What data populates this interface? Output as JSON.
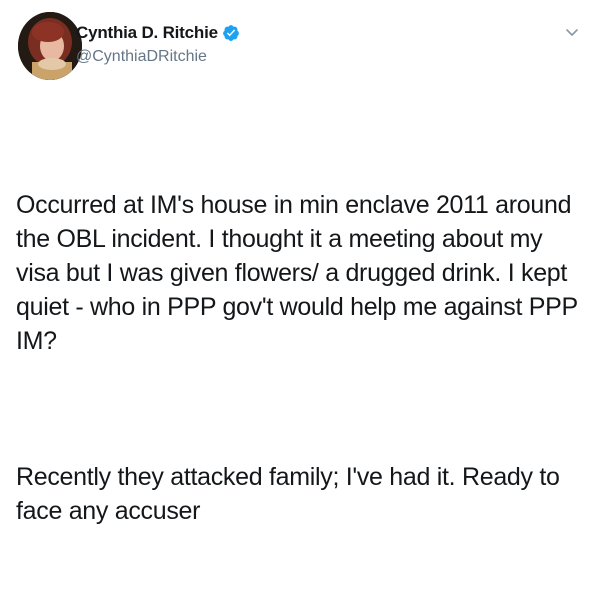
{
  "user": {
    "display_name": "Cynthia D. Ritchie",
    "handle": "@CynthiaDRitchie",
    "verified": true
  },
  "icons": {
    "avatar": "profile-photo",
    "verified": "verified-badge-icon",
    "menu": "chevron-down-icon"
  },
  "colors": {
    "verified_blue": "#1da1f2",
    "handle_gray": "#657786",
    "text": "#14171a"
  },
  "tweet": {
    "paragraph_1": "Occurred at IM's house in min enclave 2011 around the OBL incident. I thought it a meeting about my visa but I was given flowers/ a drugged drink. I kept quiet - who in PPP gov't would help me against PPP IM?",
    "paragraph_2": "Recently they attacked family; I've had it. Ready to face any accuser"
  }
}
